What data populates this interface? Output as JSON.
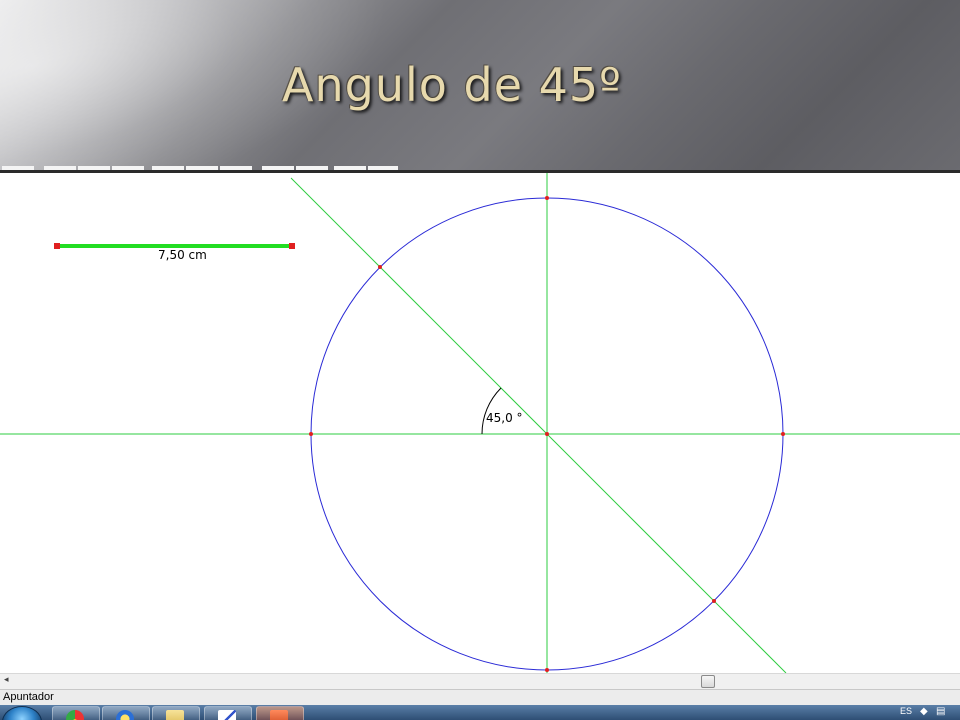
{
  "slide": {
    "title": "Angulo de 45º"
  },
  "canvas": {
    "segment_measure": "7,50 cm",
    "angle_label": "45,0 °",
    "colors": {
      "circle": "#2a2ad6",
      "lines": "#2ecc40",
      "segment": "#22dd22",
      "points": "#e02020"
    }
  },
  "statusbar": {
    "mode_text": "Apuntador"
  },
  "scrollbar": {
    "left_arrow": "◂"
  },
  "taskbar": {
    "tray_text": "ES",
    "tray_icons": [
      "shield-icon",
      "network-icon"
    ]
  }
}
